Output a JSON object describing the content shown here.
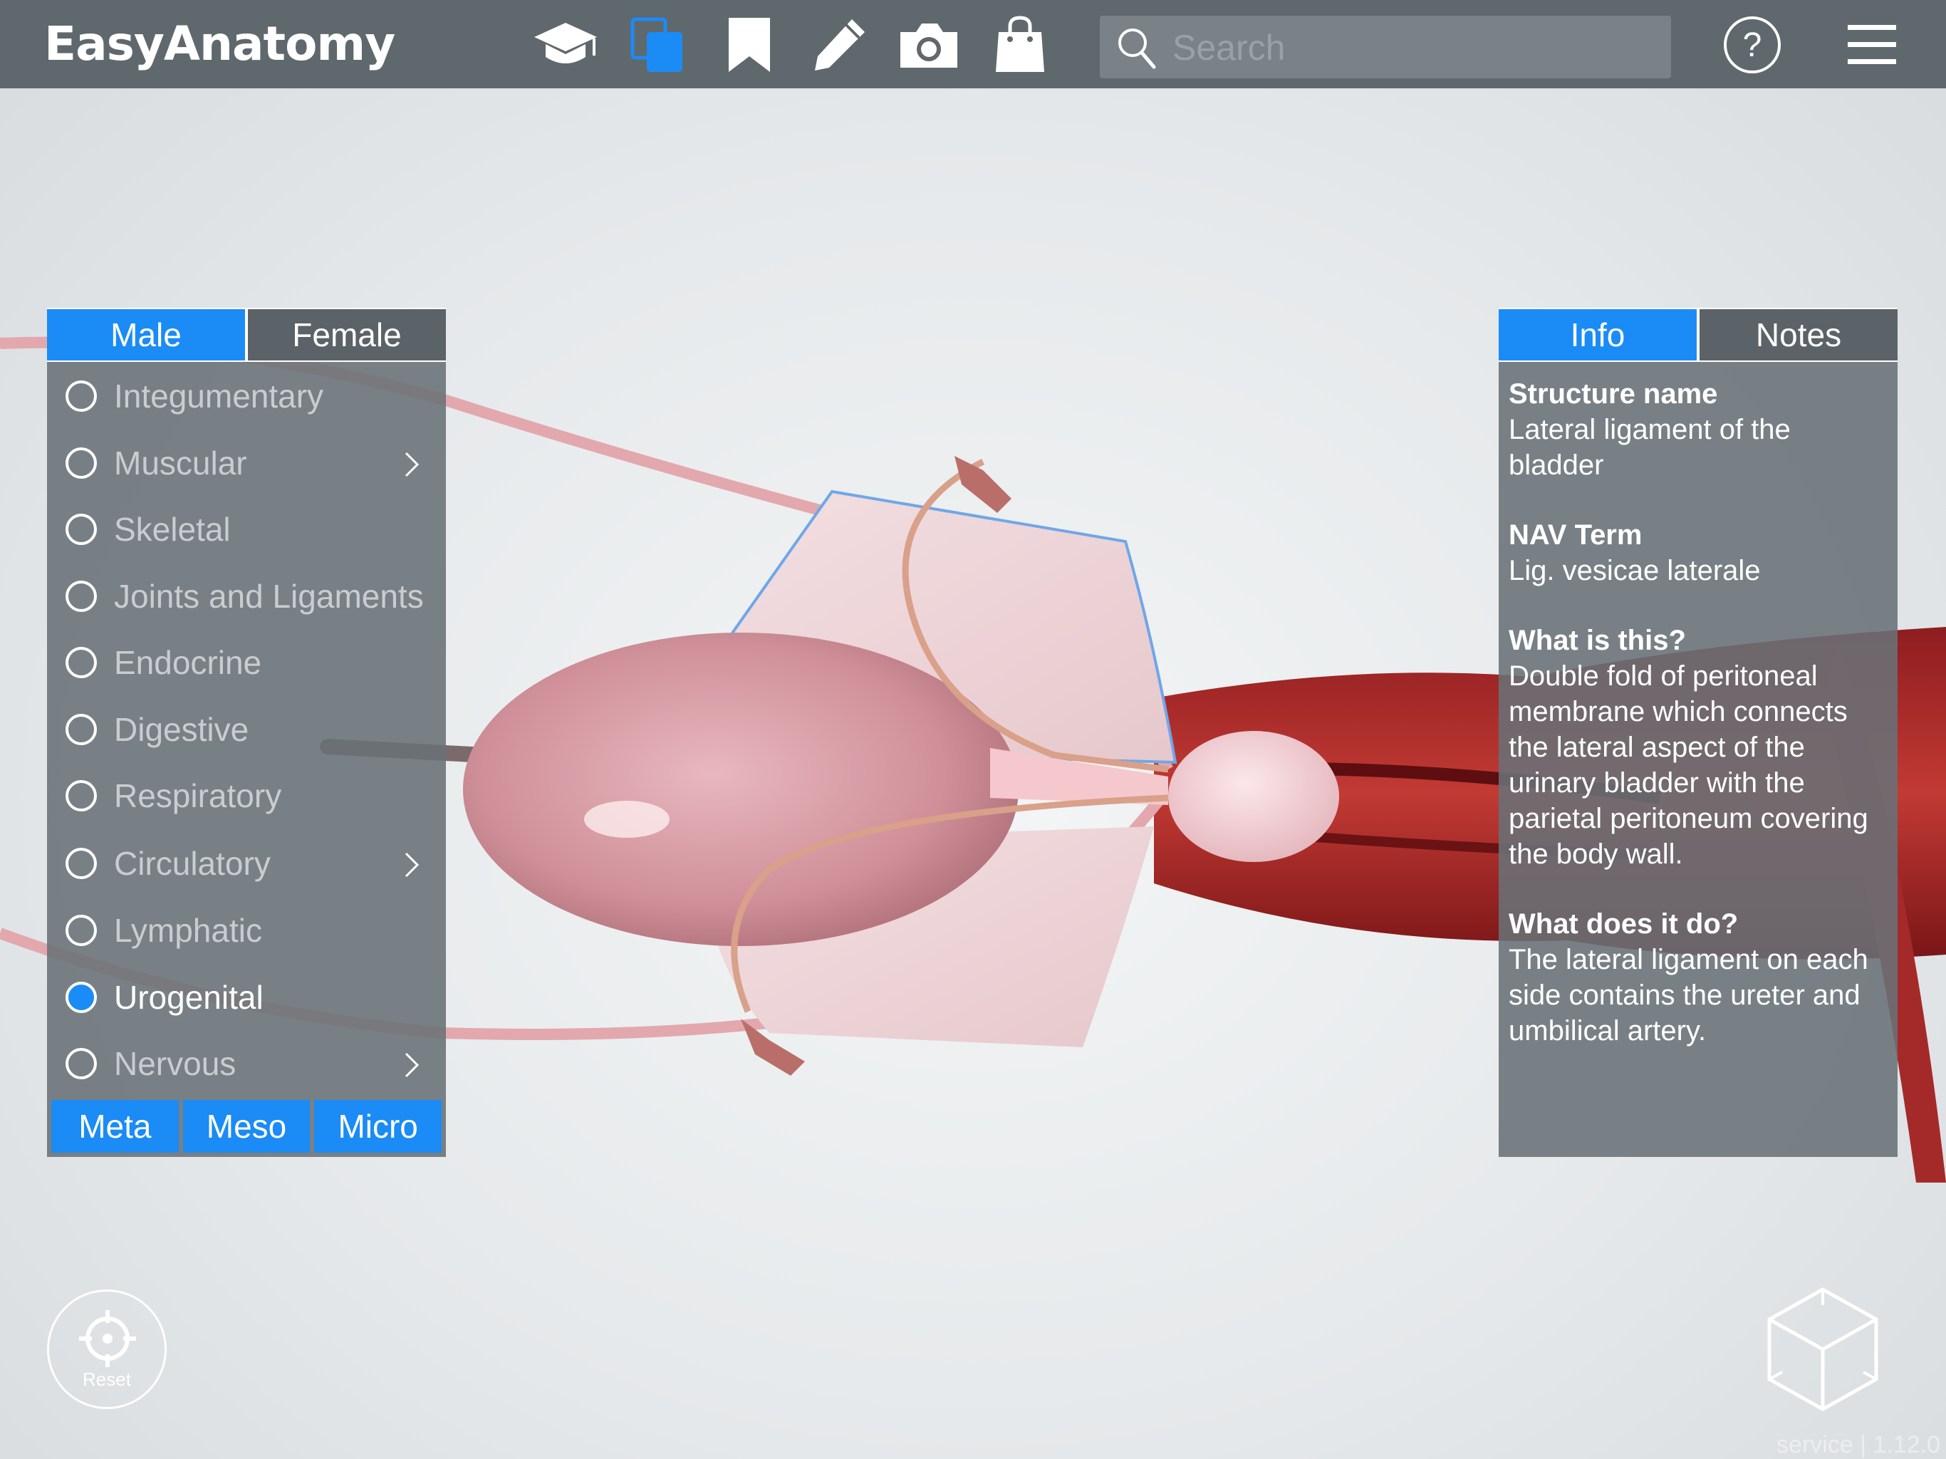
{
  "app": {
    "title": "EasyAnatomy"
  },
  "toolbar": {
    "icons": [
      "graduation-cap-icon",
      "copy-icon",
      "bookmark-icon",
      "pencil-icon",
      "camera-icon",
      "shopping-bag-icon"
    ],
    "search_placeholder": "Search"
  },
  "sex_tabs": {
    "male": "Male",
    "female": "Female",
    "active": "Male"
  },
  "systems": {
    "items": [
      {
        "label": "Integumentary",
        "selected": false,
        "has_submenu": false
      },
      {
        "label": "Muscular",
        "selected": false,
        "has_submenu": true
      },
      {
        "label": "Skeletal",
        "selected": false,
        "has_submenu": false
      },
      {
        "label": "Joints and Ligaments",
        "selected": false,
        "has_submenu": false
      },
      {
        "label": "Endocrine",
        "selected": false,
        "has_submenu": false
      },
      {
        "label": "Digestive",
        "selected": false,
        "has_submenu": false
      },
      {
        "label": "Respiratory",
        "selected": false,
        "has_submenu": false
      },
      {
        "label": "Circulatory",
        "selected": false,
        "has_submenu": true
      },
      {
        "label": "Lymphatic",
        "selected": false,
        "has_submenu": false
      },
      {
        "label": "Urogenital",
        "selected": true,
        "has_submenu": false
      },
      {
        "label": "Nervous",
        "selected": false,
        "has_submenu": true
      }
    ],
    "levels": [
      "Meta",
      "Meso",
      "Micro"
    ]
  },
  "info_tabs": {
    "info": "Info",
    "notes": "Notes",
    "active": "Info"
  },
  "info": {
    "structure_name_heading": "Structure name",
    "structure_name": "Lateral ligament of the bladder",
    "nav_term_heading": "NAV Term",
    "nav_term": "Lig. vesicae laterale",
    "what_heading": "What is this?",
    "what": "Double fold of peritoneal membrane which connects the lateral aspect of the urinary bladder with the parietal peritoneum covering the body wall.",
    "does_heading": "What does it do?",
    "does": "The lateral ligament on each side contains the ureter and umbilical artery."
  },
  "controls": {
    "reset_label": "Reset",
    "version_text": "service | 1.12.0"
  },
  "colors": {
    "accent": "#1b8bf6",
    "topbar": "#5f686d",
    "panel": "#697176"
  }
}
